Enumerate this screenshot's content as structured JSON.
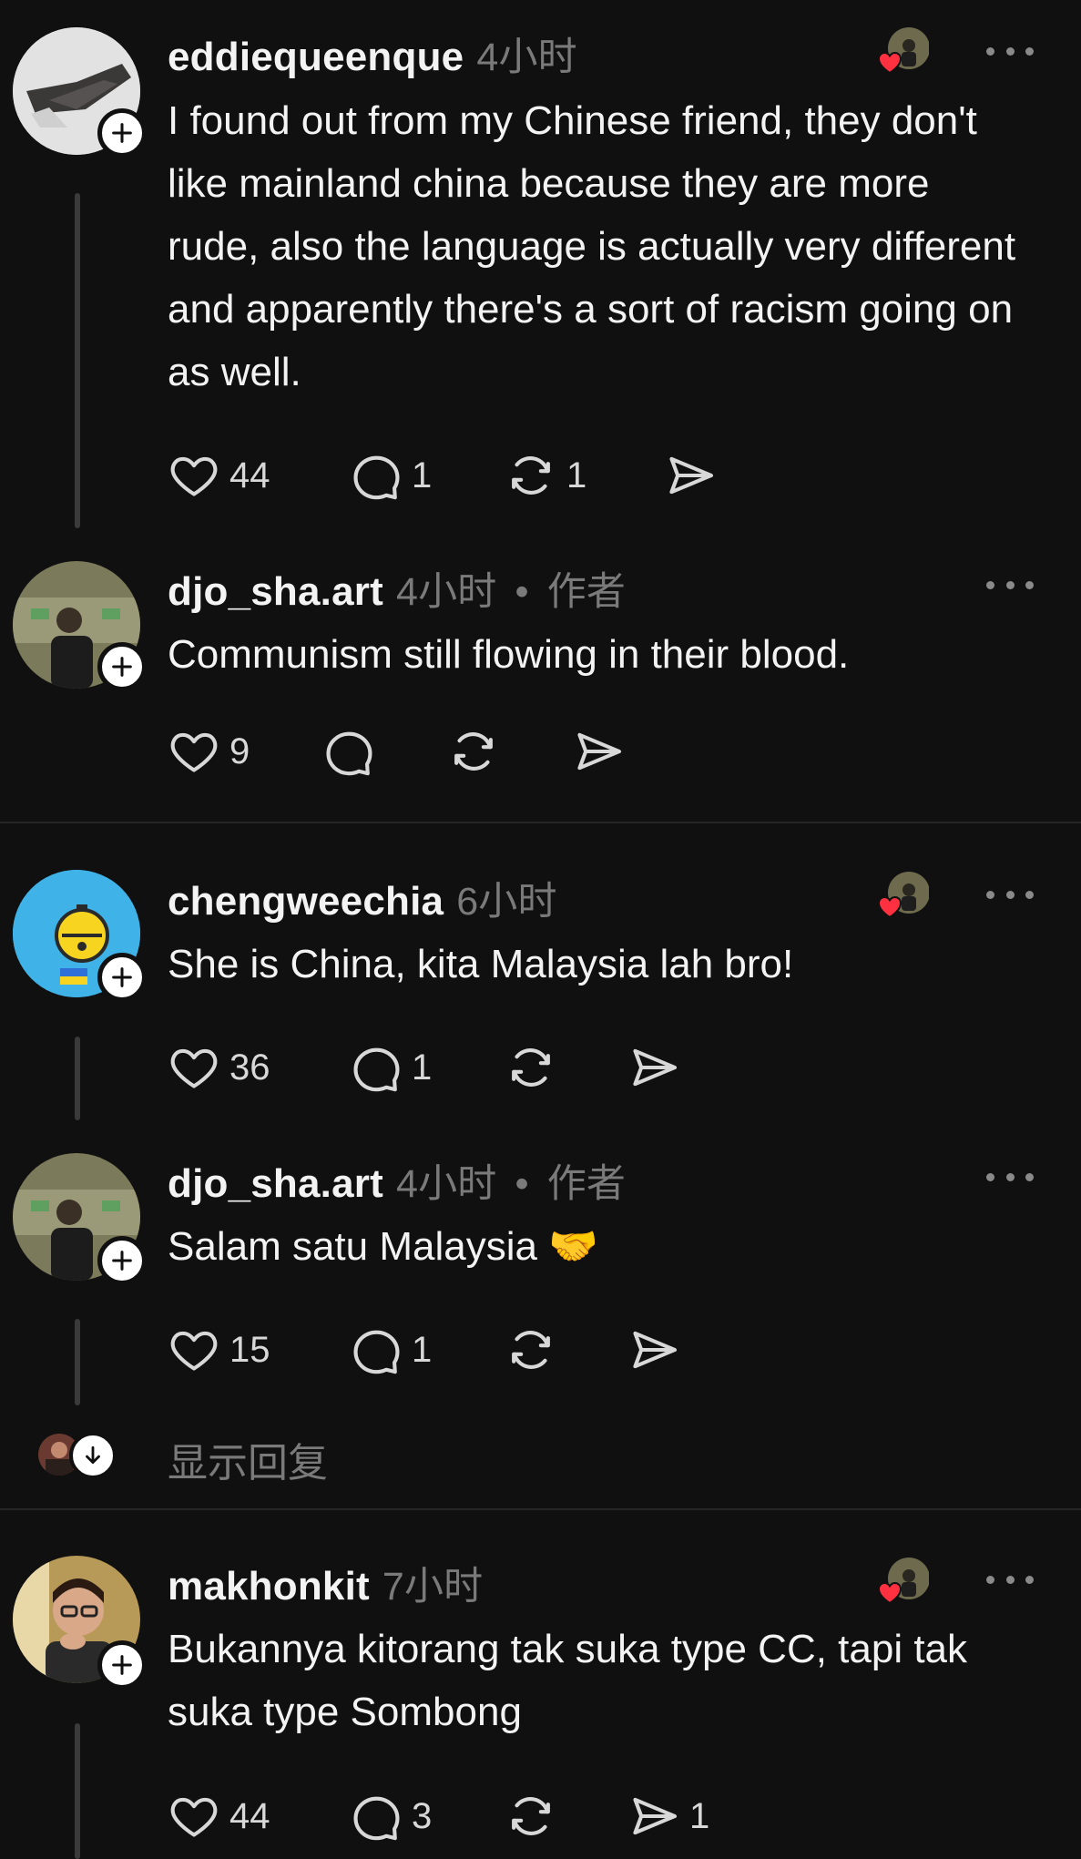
{
  "threads": [
    {
      "username": "eddiequeenque",
      "time": "4小时",
      "text": "I found out from my Chinese friend, they don't like mainland china because they are more rude, also the language is actually very different and apparently there's a sort of racism going on as well.",
      "likes": "44",
      "replies": "1",
      "reposts": "1",
      "shares": ""
    },
    {
      "username": "djo_sha.art",
      "time": "4小时",
      "author_tag": "作者",
      "text": "Communism still flowing in their blood.",
      "likes": "9",
      "replies": "",
      "reposts": "",
      "shares": ""
    },
    {
      "username": "chengweechia",
      "time": "6小时",
      "text": "She is China, kita Malaysia lah bro!",
      "likes": "36",
      "replies": "1",
      "reposts": "",
      "shares": ""
    },
    {
      "username": "djo_sha.art",
      "time": "4小时",
      "author_tag": "作者",
      "text": "Salam satu Malaysia 🤝",
      "likes": "15",
      "replies": "1",
      "reposts": "",
      "shares": ""
    },
    {
      "username": "makhonkit",
      "time": "7小时",
      "text": "Bukannya kitorang tak suka type CC, tapi tak suka type Sombong",
      "likes": "44",
      "replies": "3",
      "reposts": "",
      "shares": "1"
    }
  ],
  "show_replies_label": "显示回复",
  "colors": {
    "background": "#101010",
    "text": "#f3f3f3",
    "muted": "#7a7a7a",
    "heart_red": "#ff3040"
  },
  "icons": [
    "heart-icon",
    "comment-icon",
    "repost-icon",
    "share-icon",
    "more-icon",
    "plus-icon",
    "liked-by-author-icon",
    "arrow-down-icon"
  ]
}
